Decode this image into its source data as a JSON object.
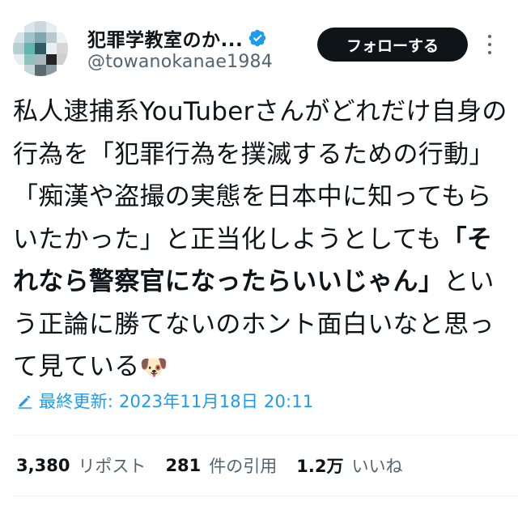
{
  "author": {
    "display_name": "犯罪学教室のか...",
    "handle": "@towanokanae1984",
    "verified_badge_icon": "verified-badge-icon",
    "avatar_icon": "pixelated-avatar"
  },
  "actions": {
    "follow_label": "フォローする",
    "more_icon": "more-vertical-icon"
  },
  "tweet": {
    "text_part1": "私人逮捕系YouTuberさんがどれだけ自身の行為を「犯罪行為を撲滅するための行動」「痴漢や盗撮の実態を日本中に知ってもらいたかった」と正当化しようとしても",
    "text_bold": "「それなら警察官になったらいいじゃん」",
    "text_part2": "という正論に勝てないのホント面白いなと思って見ている",
    "emoji": "🐶"
  },
  "edit_info": {
    "icon": "pencil-icon",
    "text": "最終更新: 2023年11月18日 20:11"
  },
  "stats": {
    "reposts": {
      "count": "3,380",
      "label": "リポスト"
    },
    "quotes": {
      "count": "281",
      "label": "件の引用"
    },
    "likes": {
      "count": "1.2万",
      "label": "いいね"
    }
  },
  "colors": {
    "text": "#0f1419",
    "secondary": "#536471",
    "accent": "#1d9bf0",
    "follow_bg": "#0f1419",
    "divider": "#eff3f4"
  }
}
